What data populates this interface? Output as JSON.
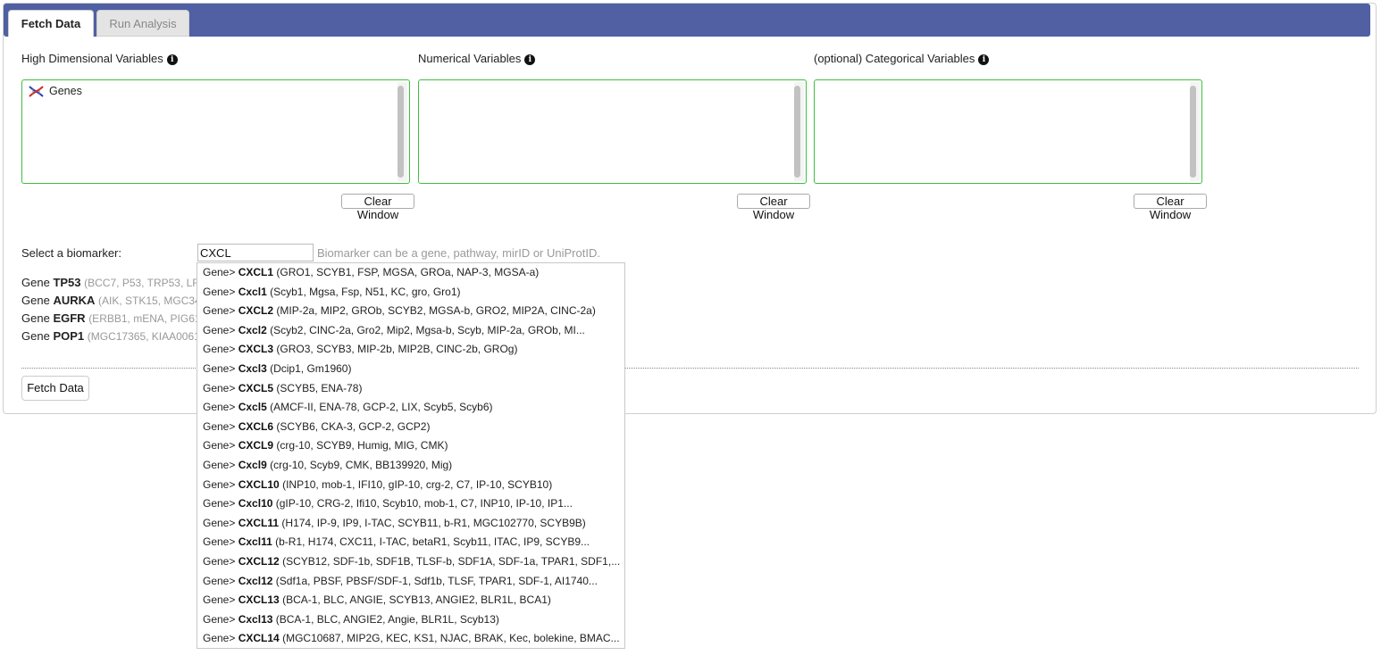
{
  "tabs": [
    {
      "label": "Fetch Data",
      "active": true
    },
    {
      "label": "Run Analysis",
      "active": false
    }
  ],
  "columns": [
    {
      "label": "High Dimensional Variables",
      "items": [
        {
          "icon": "dna-icon",
          "label": "Genes"
        }
      ]
    },
    {
      "label": "Numerical Variables",
      "items": []
    },
    {
      "label": "(optional) Categorical Variables",
      "items": []
    }
  ],
  "clear_label": "Clear Window",
  "info_glyph": "i",
  "biomarker": {
    "label": "Select a biomarker:",
    "value": "CXCL",
    "hint": "Biomarker can be a gene, pathway, mirID or UniProtID."
  },
  "gene_list": [
    {
      "prefix": "Gene",
      "symbol": "TP53",
      "aliases": "(BCC7, P53, TRP53, LFS1)"
    },
    {
      "prefix": "Gene",
      "symbol": "AURKA",
      "aliases": "(AIK, STK15, MGC34538)"
    },
    {
      "prefix": "Gene",
      "symbol": "EGFR",
      "aliases": "(ERBB1, mENA, PIG61)"
    },
    {
      "prefix": "Gene",
      "symbol": "POP1",
      "aliases": "(MGC17365, KIAA0061)"
    }
  ],
  "fetch_label": "Fetch Data",
  "suggestions": [
    {
      "prefix": "Gene>",
      "symbol": "CXCL1",
      "aliases": "(GRO1, SCYB1, FSP, MGSA, GROa, NAP-3, MGSA-a)"
    },
    {
      "prefix": "Gene>",
      "symbol": "Cxcl1",
      "aliases": "(Scyb1, Mgsa, Fsp, N51, KC, gro, Gro1)"
    },
    {
      "prefix": "Gene>",
      "symbol": "CXCL2",
      "aliases": "(MIP-2a, MIP2, GROb, SCYB2, MGSA-b, GRO2, MIP2A, CINC-2a)"
    },
    {
      "prefix": "Gene>",
      "symbol": "Cxcl2",
      "aliases": "(Scyb2, CINC-2a, Gro2, Mip2, Mgsa-b, Scyb, MIP-2a, GROb, MI..."
    },
    {
      "prefix": "Gene>",
      "symbol": "CXCL3",
      "aliases": "(GRO3, SCYB3, MIP-2b, MIP2B, CINC-2b, GROg)"
    },
    {
      "prefix": "Gene>",
      "symbol": "Cxcl3",
      "aliases": "(Dcip1, Gm1960)"
    },
    {
      "prefix": "Gene>",
      "symbol": "CXCL5",
      "aliases": "(SCYB5, ENA-78)"
    },
    {
      "prefix": "Gene>",
      "symbol": "Cxcl5",
      "aliases": "(AMCF-II, ENA-78, GCP-2, LIX, Scyb5, Scyb6)"
    },
    {
      "prefix": "Gene>",
      "symbol": "CXCL6",
      "aliases": "(SCYB6, CKA-3, GCP-2, GCP2)"
    },
    {
      "prefix": "Gene>",
      "symbol": "CXCL9",
      "aliases": "(crg-10, SCYB9, Humig, MIG, CMK)"
    },
    {
      "prefix": "Gene>",
      "symbol": "Cxcl9",
      "aliases": "(crg-10, Scyb9, CMK, BB139920, Mig)"
    },
    {
      "prefix": "Gene>",
      "symbol": "CXCL10",
      "aliases": "(INP10, mob-1, IFI10, gIP-10, crg-2, C7, IP-10, SCYB10)"
    },
    {
      "prefix": "Gene>",
      "symbol": "Cxcl10",
      "aliases": "(gIP-10, CRG-2, Ifi10, Scyb10, mob-1, C7, INP10, IP-10, IP1..."
    },
    {
      "prefix": "Gene>",
      "symbol": "CXCL11",
      "aliases": "(H174, IP-9, IP9, I-TAC, SCYB11, b-R1, MGC102770, SCYB9B)"
    },
    {
      "prefix": "Gene>",
      "symbol": "Cxcl11",
      "aliases": "(b-R1, H174, CXC11, I-TAC, betaR1, Scyb11, ITAC, IP9, SCYB9..."
    },
    {
      "prefix": "Gene>",
      "symbol": "CXCL12",
      "aliases": "(SCYB12, SDF-1b, SDF1B, TLSF-b, SDF1A, SDF-1a, TPAR1, SDF1,..."
    },
    {
      "prefix": "Gene>",
      "symbol": "Cxcl12",
      "aliases": "(Sdf1a, PBSF, PBSF/SDF-1, Sdf1b, TLSF, TPAR1, SDF-1, AI1740..."
    },
    {
      "prefix": "Gene>",
      "symbol": "CXCL13",
      "aliases": "(BCA-1, BLC, ANGIE, SCYB13, ANGIE2, BLR1L, BCA1)"
    },
    {
      "prefix": "Gene>",
      "symbol": "Cxcl13",
      "aliases": "(BCA-1, BLC, ANGIE2, Angie, BLR1L, Scyb13)"
    },
    {
      "prefix": "Gene>",
      "symbol": "CXCL14",
      "aliases": "(MGC10687, MIP2G, KEC, KS1, NJAC, BRAK, Kec, bolekine, BMAC..."
    }
  ]
}
